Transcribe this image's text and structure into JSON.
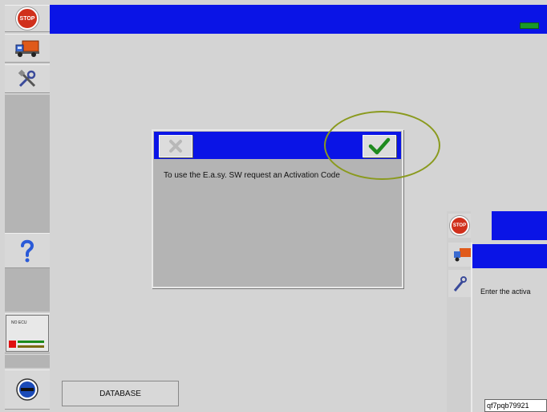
{
  "sidebar": {
    "stop_icon": "stop-icon",
    "stop_label": "STOP",
    "truck_icon": "truck-icon",
    "tools_icon": "tools-icon",
    "help_icon": "question-icon",
    "ecu_label": "NO ECU",
    "key_icon": "ignition-key-icon"
  },
  "dialog": {
    "cancel_icon": "close-icon",
    "ok_icon": "checkmark-icon",
    "message": "To use the E.a.sy. SW request an Activation Code"
  },
  "database_button": "DATABASE",
  "secondary_window": {
    "stop_label": "STOP",
    "message": "Enter the activa",
    "input_value": "qf7pqb79921"
  },
  "colors": {
    "title_bar": "#0a14e6",
    "background": "#d4d4d4",
    "highlight_ring": "#8a9a1e",
    "check": "#1f8a1f"
  }
}
